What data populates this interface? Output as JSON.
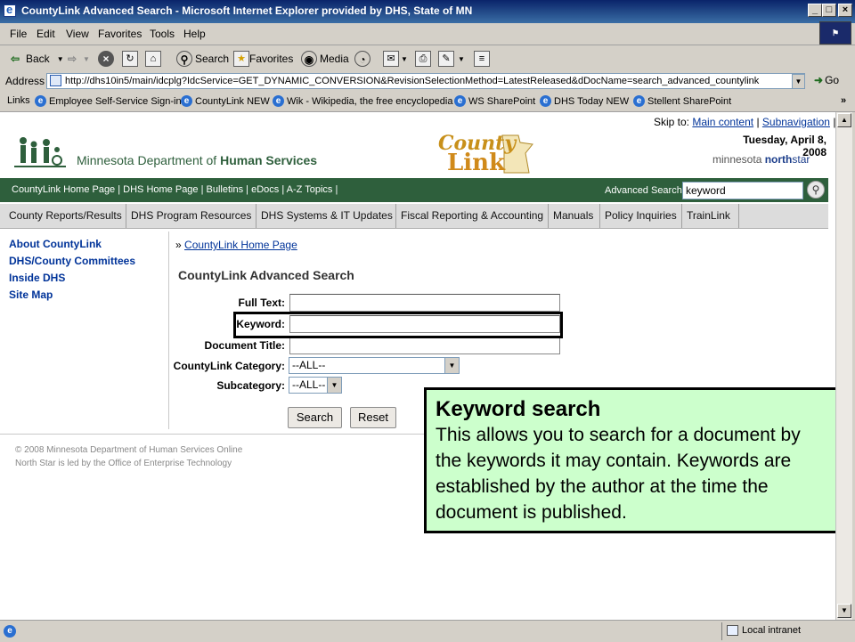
{
  "window": {
    "title": "CountyLink Advanced Search - Microsoft Internet Explorer provided by DHS, State of MN",
    "controls": [
      "_",
      "□",
      "×"
    ]
  },
  "menu": [
    "File",
    "Edit",
    "View",
    "Favorites",
    "Tools",
    "Help"
  ],
  "toolbar": {
    "back": "Back",
    "search": "Search",
    "favorites": "Favorites",
    "media": "Media"
  },
  "address": {
    "label": "Address",
    "url": "http://dhs10in5/main/idcplg?IdcService=GET_DYNAMIC_CONVERSION&RevisionSelectionMethod=LatestReleased&dDocName=search_advanced_countylink",
    "go": "Go"
  },
  "links_bar": {
    "label": "Links",
    "items": [
      "Employee Self-Service Sign-in",
      "CountyLink NEW",
      "Wik - Wikipedia, the free encyclopedia",
      "WS SharePoint",
      "DHS Today NEW",
      "Stellent SharePoint"
    ],
    "more": "»"
  },
  "page": {
    "skip": {
      "prefix": "Skip to:",
      "main": "Main content",
      "sub": "Subnavigation",
      "sep": "|"
    },
    "date": "Tuesday, April 8, 2008",
    "northstar": {
      "a": "minnesota ",
      "b": "north",
      "c": "star"
    },
    "dept": {
      "pre": "Minnesota Department of ",
      "bold": "Human Services"
    },
    "logo_text": {
      "a": "County",
      "b": "Link"
    },
    "green_nav": [
      "CountyLink Home Page",
      "DHS Home Page",
      "Bulletins",
      "eDocs",
      "A-Z Topics"
    ],
    "advanced_search_label": "Advanced Search",
    "top_search_value": "keyword",
    "tabs": [
      "County Reports/Results",
      "DHS Program Resources",
      "DHS Systems & IT Updates",
      "Fiscal Reporting & Accounting",
      "Manuals",
      "Policy Inquiries",
      "TrainLink"
    ],
    "left_nav": [
      "About CountyLink",
      "DHS/County Committees",
      "Inside DHS",
      "Site Map"
    ],
    "breadcrumb_prefix": "»",
    "breadcrumb": "CountyLink Home Page",
    "heading": "CountyLink Advanced Search",
    "form": {
      "full_text": "Full Text:",
      "keyword": "Keyword:",
      "doc_title": "Document Title:",
      "category": "CountyLink Category:",
      "category_value": "--ALL--",
      "subcategory": "Subcategory:",
      "subcategory_value": "--ALL--",
      "search_btn": "Search",
      "reset_btn": "Reset"
    },
    "footer": [
      "© 2008 Minnesota Department of Human Services Online",
      "North Star is led by the Office of Enterprise Technology"
    ]
  },
  "callout": {
    "title": "Keyword search",
    "body": "This allows you to search for a document by the keywords it may contain. Keywords are established by the author at the time the document is published."
  },
  "status": {
    "zone": "Local intranet"
  },
  "colors": {
    "titlebar": "#0a246a",
    "green_nav": "#2e5f3c",
    "callout_bg": "#ccffcc",
    "link": "#003399"
  }
}
